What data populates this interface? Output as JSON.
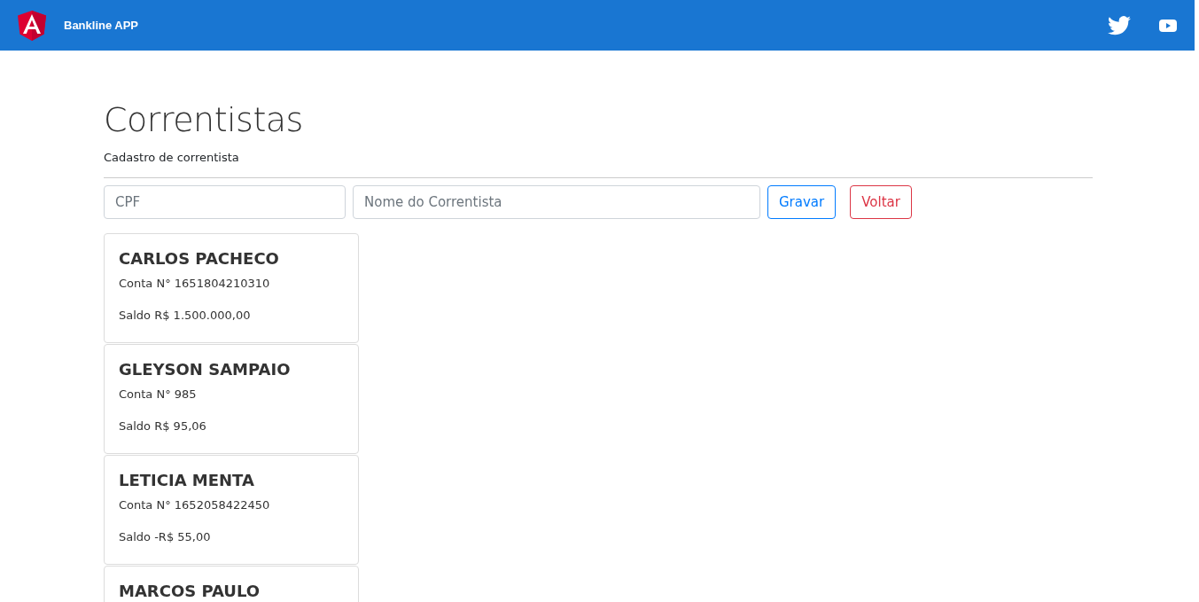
{
  "navbar": {
    "brand": "Bankline APP"
  },
  "header": {
    "title": "Correntistas",
    "subtitle": "Cadastro de correntista"
  },
  "form": {
    "fields": [
      {
        "placeholder": "CPF"
      },
      {
        "placeholder": "Nome do Correntista"
      }
    ],
    "buttons": [
      {
        "label": "Gravar",
        "kind": "primary"
      },
      {
        "label": "Voltar",
        "kind": "danger"
      }
    ]
  },
  "accounts": [
    {
      "name": "CARLOS PACHECO",
      "account": "Conta N° 1651804210310",
      "balance": "Saldo R$ 1.500.000,00"
    },
    {
      "name": "GLEYSON SAMPAIO",
      "account": "Conta N° 985",
      "balance": "Saldo R$ 95,06"
    },
    {
      "name": "LETICIA MENTA",
      "account": "Conta N° 1652058422450",
      "balance": "Saldo -R$ 55,00"
    },
    {
      "name": "MARCOS PAULO"
    }
  ]
}
